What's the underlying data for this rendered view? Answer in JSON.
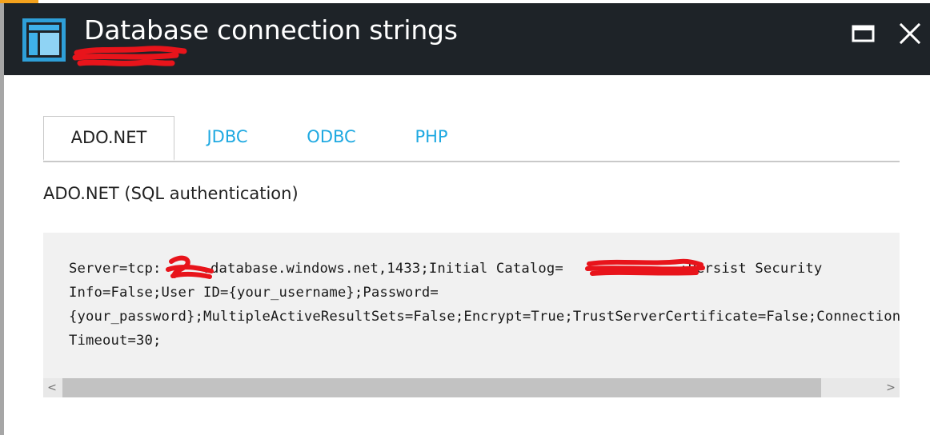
{
  "header": {
    "title": "Database connection strings",
    "maximize_icon": "maximize-icon",
    "close_icon": "close-icon",
    "blade_icon": "blade-icon"
  },
  "tabs": [
    {
      "label": "ADO.NET",
      "active": true
    },
    {
      "label": "JDBC",
      "active": false
    },
    {
      "label": "ODBC",
      "active": false
    },
    {
      "label": "PHP",
      "active": false
    }
  ],
  "section": {
    "heading": "ADO.NET (SQL authentication)"
  },
  "connection_string": {
    "line1_part1": "Server=tcp:",
    "line1_part2": ".database.windows.net,1433;Initial Catalog=",
    "line1_part3": ";Persist Security",
    "line2": "Info=False;User ID={your_username};Password=",
    "line3": "{your_password};MultipleActiveResultSets=False;Encrypt=True;TrustServerCertificate=False;Connection",
    "line4": "Timeout=30;"
  },
  "scrollbar": {
    "left_arrow": "<",
    "right_arrow": ">"
  },
  "colors": {
    "header_bg": "#1e2328",
    "link": "#1fa9e1",
    "accent": "#f4a21d",
    "code_bg": "#f1f1f1",
    "redaction": "#e8141b"
  }
}
